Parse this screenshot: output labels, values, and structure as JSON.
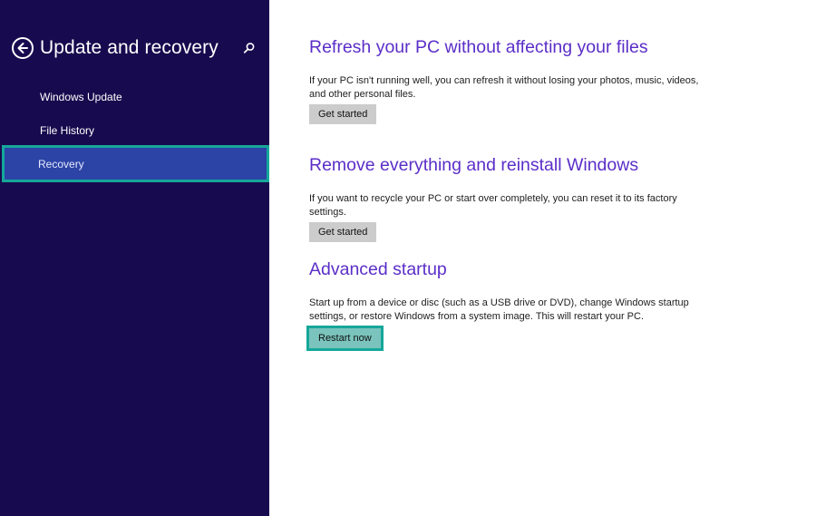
{
  "sidebar": {
    "title": "Update and recovery",
    "items": [
      {
        "label": "Windows Update"
      },
      {
        "label": "File History"
      },
      {
        "label": "Recovery",
        "active": true
      }
    ]
  },
  "sections": [
    {
      "title": "Refresh your PC without affecting your files",
      "description": "If your PC isn't running well, you can refresh it without losing your photos, music, videos, and other personal files.",
      "button": "Get started"
    },
    {
      "title": "Remove everything and reinstall Windows",
      "description": "If you want to recycle your PC or start over completely, you can reset it to its factory settings.",
      "button": "Get started"
    },
    {
      "title": "Advanced startup",
      "description": "Start up from a device or disc (such as a USB drive or DVD), change Windows startup settings, or restore Windows from a system image. This will restart your PC.",
      "button": "Restart now"
    }
  ],
  "icons": {
    "back": "back-arrow-icon",
    "search": "search-icon"
  },
  "colors": {
    "sidebar_bg": "#180a4e",
    "active_item_bg": "#2c44a6",
    "highlight_outline": "#15a79a",
    "heading": "#5b2ec8",
    "button_bg": "#cccccc",
    "restart_button_bg": "#7ac4bd"
  }
}
